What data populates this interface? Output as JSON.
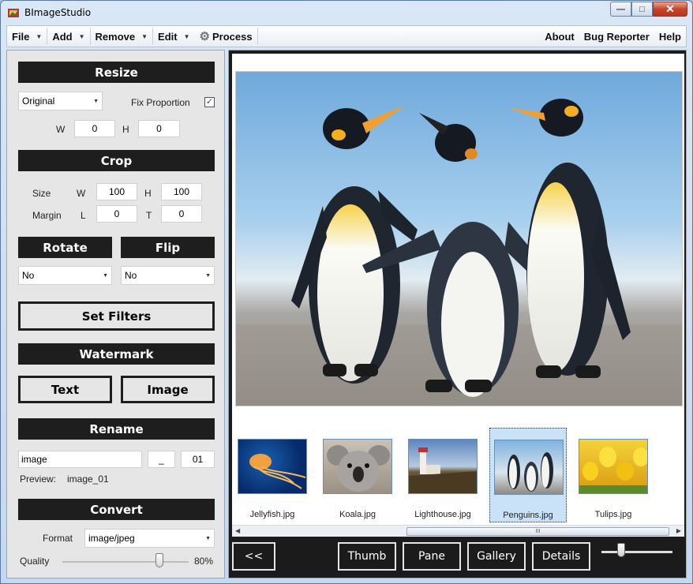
{
  "window": {
    "title": "BImageStudio"
  },
  "menu": {
    "file": "File",
    "add": "Add",
    "remove": "Remove",
    "edit": "Edit",
    "process": "Process",
    "about": "About",
    "bug_reporter": "Bug Reporter",
    "help": "Help"
  },
  "resize": {
    "header": "Resize",
    "mode": "Original",
    "fix_proportion_label": "Fix Proportion",
    "fix_proportion_checked": true,
    "w_label": "W",
    "h_label": "H",
    "w_value": "0",
    "h_value": "0"
  },
  "crop": {
    "header": "Crop",
    "size_label": "Size",
    "margin_label": "Margin",
    "w_label": "W",
    "h_label": "H",
    "l_label": "L",
    "t_label": "T",
    "w_value": "100",
    "h_value": "100",
    "l_value": "0",
    "t_value": "0"
  },
  "rotate": {
    "header": "Rotate",
    "value": "No"
  },
  "flip": {
    "header": "Flip",
    "value": "No"
  },
  "filters": {
    "button": "Set Filters"
  },
  "watermark": {
    "header": "Watermark",
    "text_button": "Text",
    "image_button": "Image"
  },
  "rename": {
    "header": "Rename",
    "name_value": "image",
    "separator_value": "_",
    "start_value": "01",
    "preview_label": "Preview:",
    "preview_value": "image_01"
  },
  "convert": {
    "header": "Convert",
    "format_label": "Format",
    "format_value": "image/jpeg",
    "quality_label": "Quality",
    "quality_value": "80%",
    "quality_level": 0.8
  },
  "thumbnails": [
    {
      "name": "Jellyfish.jpg",
      "selected": false
    },
    {
      "name": "Koala.jpg",
      "selected": false
    },
    {
      "name": "Lighthouse.jpg",
      "selected": false
    },
    {
      "name": "Penguins.jpg",
      "selected": true
    },
    {
      "name": "Tulips.jpg",
      "selected": false
    }
  ],
  "scrollbar": {
    "grip": "III"
  },
  "bottom_bar": {
    "back": "<<",
    "thumb": "Thumb",
    "pane": "Pane",
    "gallery": "Gallery",
    "details": "Details"
  },
  "icons": {
    "app": "app-icon",
    "process": "gear-icon",
    "minimize": "minimize-icon",
    "maximize": "maximize-icon",
    "close": "close-icon"
  },
  "colors": {
    "section_header": "#1e1e1e",
    "panel_bg": "#e6e6e6",
    "selected_thumb": "#c9e2f8",
    "close_button": "#c7452d"
  }
}
